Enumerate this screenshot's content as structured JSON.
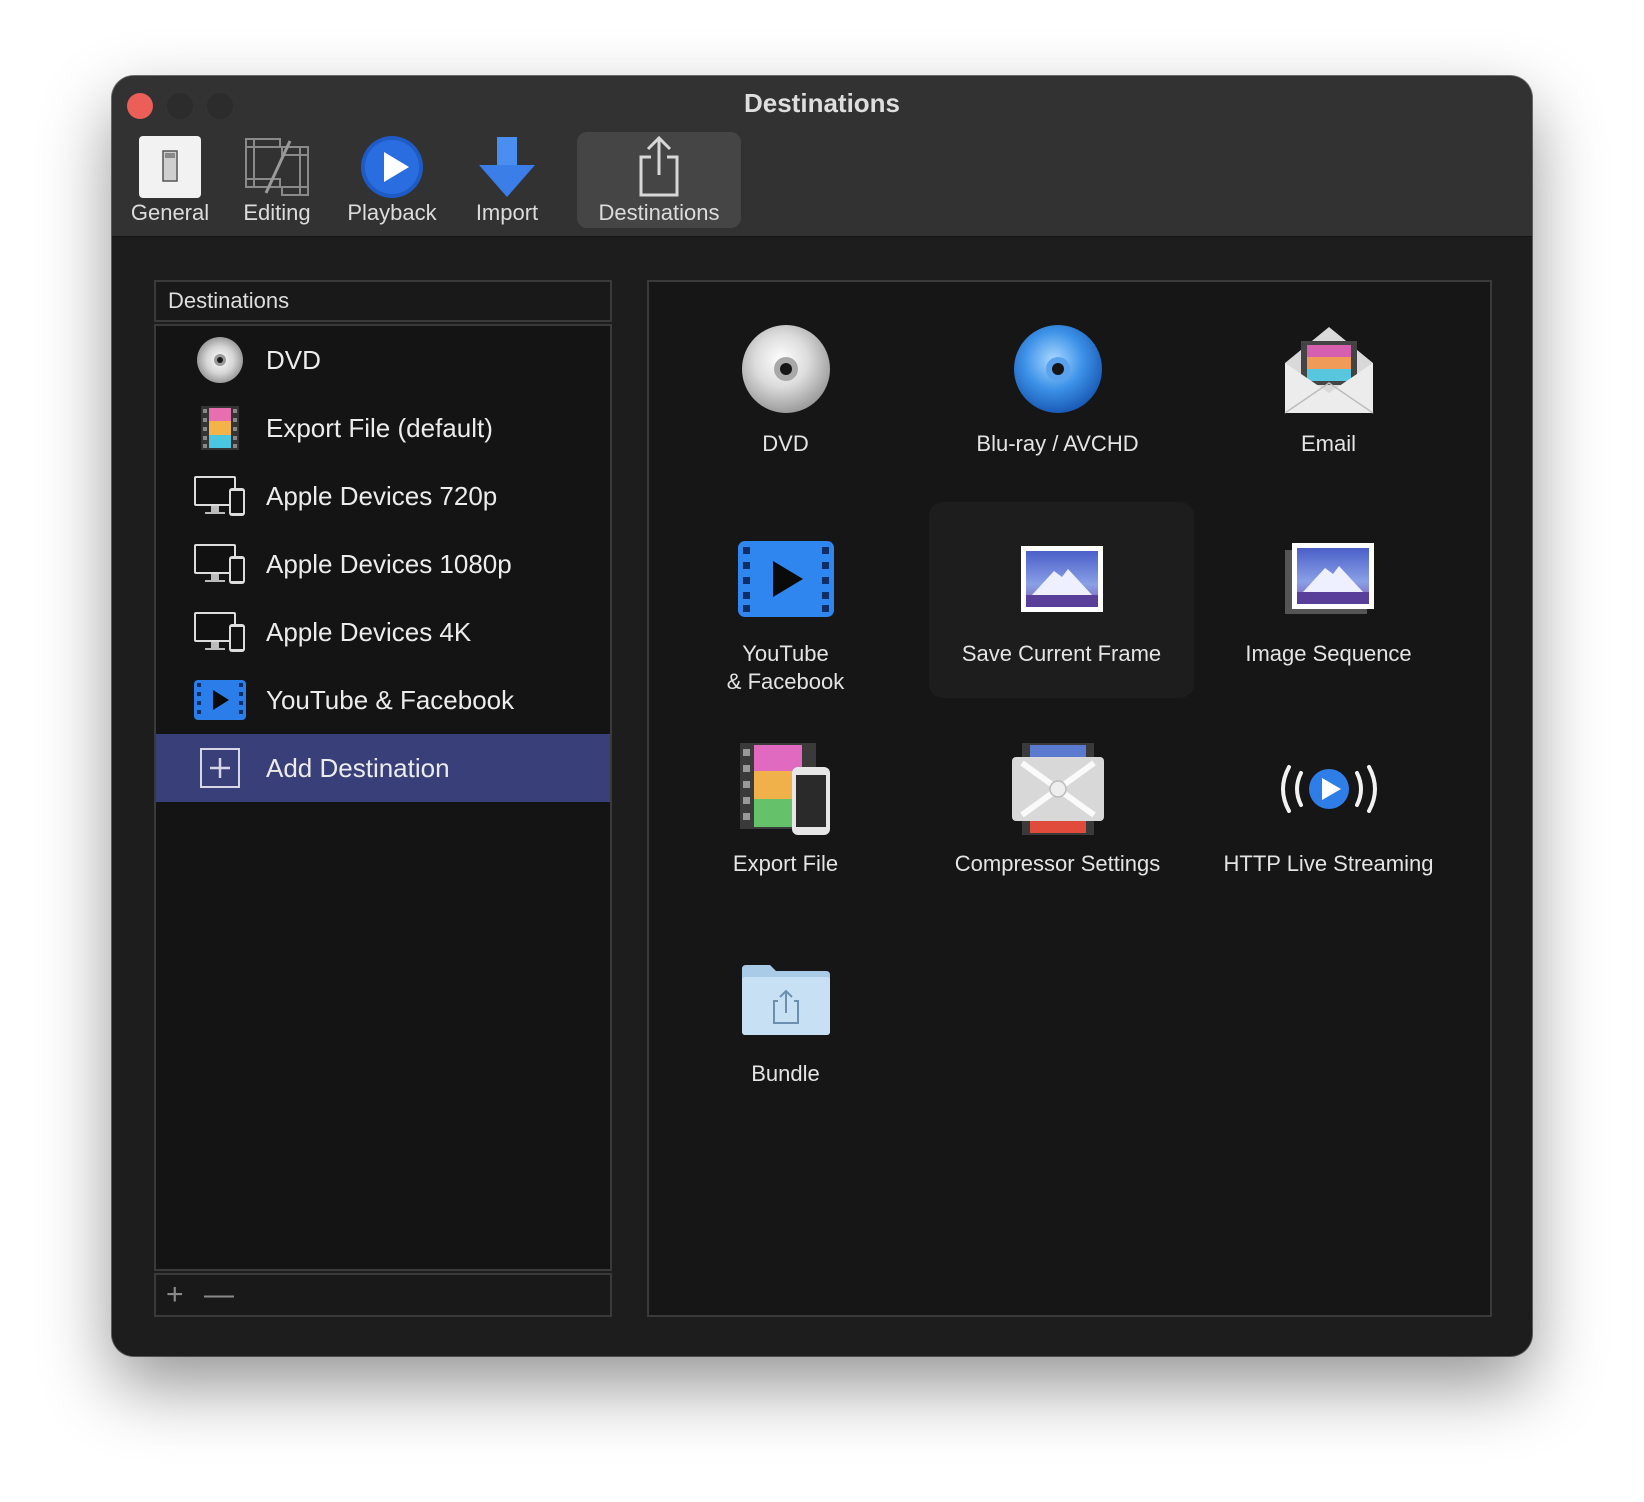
{
  "window": {
    "title": "Destinations"
  },
  "toolbar": {
    "tabs": [
      {
        "label": "General",
        "icon": "general-switch-icon"
      },
      {
        "label": "Editing",
        "icon": "editing-film-icon"
      },
      {
        "label": "Playback",
        "icon": "playback-icon"
      },
      {
        "label": "Import",
        "icon": "import-arrow-icon"
      },
      {
        "label": "Destinations",
        "icon": "share-icon"
      }
    ],
    "active_tab": "Destinations"
  },
  "sidebar": {
    "header": "Destinations",
    "items": [
      {
        "label": "DVD",
        "icon": "dvd-disc-icon"
      },
      {
        "label": "Export File (default)",
        "icon": "export-file-icon"
      },
      {
        "label": "Apple Devices 720p",
        "icon": "apple-devices-icon"
      },
      {
        "label": "Apple Devices 1080p",
        "icon": "apple-devices-icon"
      },
      {
        "label": "Apple Devices 4K",
        "icon": "apple-devices-icon"
      },
      {
        "label": "YouTube & Facebook",
        "icon": "youtube-facebook-icon"
      },
      {
        "label": "Add Destination",
        "icon": "add-destination-icon"
      }
    ],
    "selected": "Add Destination",
    "footer": {
      "add_label": "+",
      "remove_label": "—"
    }
  },
  "destinations_grid": {
    "items": [
      {
        "label": "DVD",
        "icon": "dvd-disc-icon"
      },
      {
        "label": "Blu-ray / AVCHD",
        "icon": "bluray-disc-icon"
      },
      {
        "label": "Email",
        "icon": "email-envelope-icon"
      },
      {
        "label": "YouTube\n& Facebook",
        "icon": "youtube-facebook-icon"
      },
      {
        "label": "Save Current Frame",
        "icon": "save-frame-icon"
      },
      {
        "label": "Image Sequence",
        "icon": "image-sequence-icon"
      },
      {
        "label": "Export File",
        "icon": "export-file-icon"
      },
      {
        "label": "Compressor Settings",
        "icon": "compressor-icon"
      },
      {
        "label": "HTTP Live Streaming",
        "icon": "live-streaming-icon"
      },
      {
        "label": "Bundle",
        "icon": "bundle-folder-icon"
      }
    ],
    "hovered": "Save Current Frame"
  },
  "colors": {
    "window_bg": "#1d1d1d",
    "titlebar_bg": "#323232",
    "selection": "#393f79",
    "close_button": "#ec5f58"
  }
}
